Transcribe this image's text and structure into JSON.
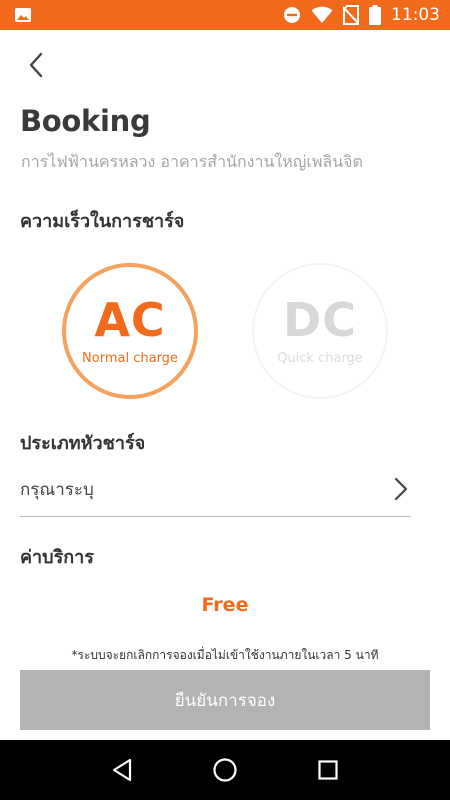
{
  "status_bar": {
    "time": "11:03",
    "icons": [
      "image-icon",
      "do-not-disturb-icon",
      "wifi-icon",
      "no-sim-icon",
      "battery-icon"
    ]
  },
  "header": {
    "back_icon": "chevron-left-icon",
    "title": "Booking",
    "station_name": "การไฟฟ้านครหลวง อาคารสำนักงานใหญ่เพลินจิต"
  },
  "charge_speed": {
    "heading": "ความเร็วในการชาร์จ",
    "options": [
      {
        "code": "AC",
        "label": "Normal charge",
        "selected": true
      },
      {
        "code": "DC",
        "label": "Quick charge",
        "selected": false
      }
    ]
  },
  "charger_type": {
    "heading": "ประเภทหัวชาร์จ",
    "placeholder": "กรุณาระบุ"
  },
  "service_fee": {
    "heading": "ค่าบริการ",
    "value": "Free"
  },
  "notice": "*ระบบจะยกเลิกการจองเมื่อไม่เข้าใช้งานภายในเวลา 5 นาที",
  "confirm_button": "ยืนยันการจอง",
  "nav_bar": {
    "icons": [
      "back-triangle-icon",
      "home-circle-icon",
      "recents-square-icon"
    ]
  },
  "colors": {
    "accent": "#f26b1d",
    "ring": "#f7a15f",
    "disabled_button": "#b3b3b3"
  }
}
